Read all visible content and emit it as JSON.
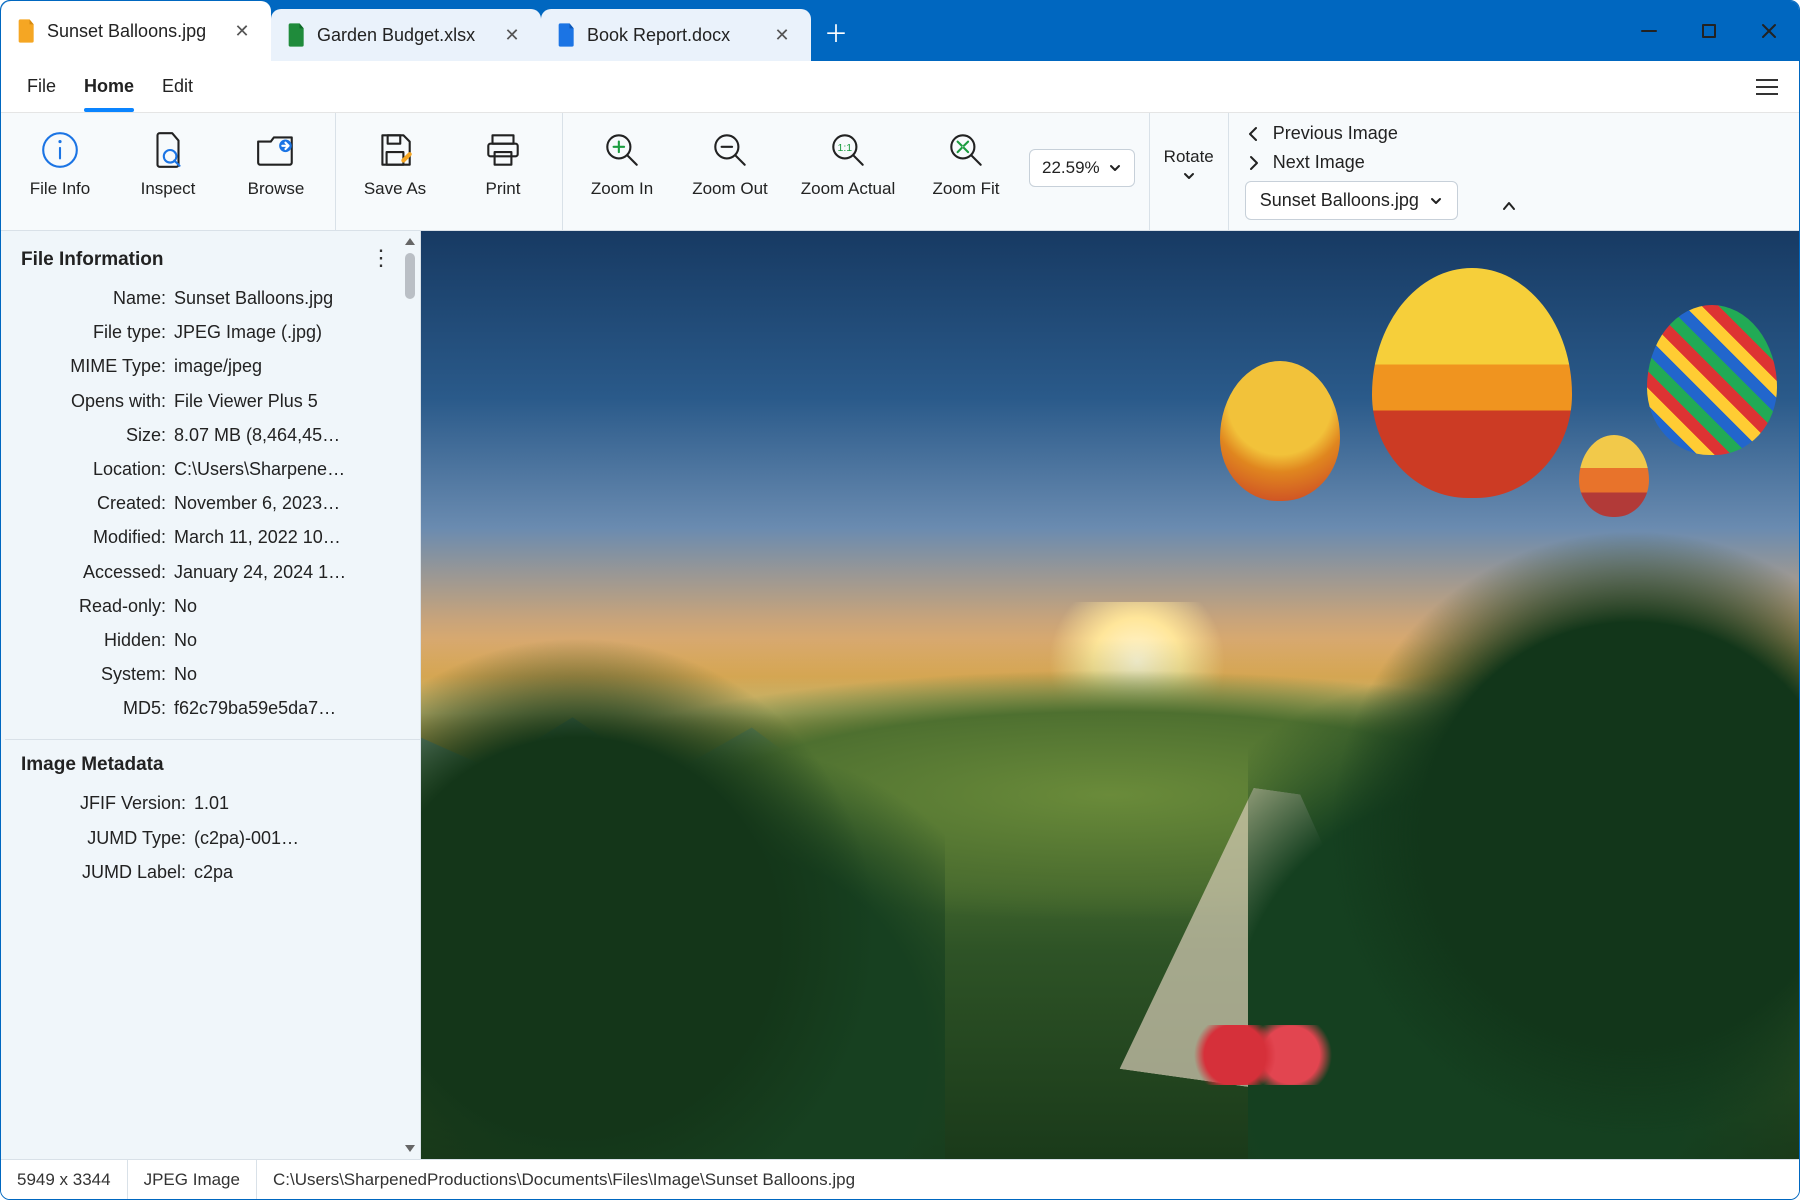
{
  "tabs": [
    {
      "label": "Sunset Balloons.jpg",
      "icon": "orange"
    },
    {
      "label": "Garden Budget.xlsx",
      "icon": "green"
    },
    {
      "label": "Book Report.docx",
      "icon": "blue"
    }
  ],
  "menus": {
    "file": "File",
    "home": "Home",
    "edit": "Edit"
  },
  "ribbon": {
    "file_info": "File Info",
    "inspect": "Inspect",
    "browse": "Browse",
    "save_as": "Save As",
    "print": "Print",
    "zoom_in": "Zoom In",
    "zoom_out": "Zoom Out",
    "zoom_actual": "Zoom Actual",
    "zoom_fit": "Zoom Fit",
    "zoom_value": "22.59%",
    "rotate": "Rotate",
    "prev": "Previous Image",
    "next": "Next Image",
    "current_file": "Sunset Balloons.jpg"
  },
  "panel": {
    "file_info_title": "File Information",
    "rows": [
      {
        "k": "Name:",
        "v": "Sunset Balloons.jpg"
      },
      {
        "k": "File type:",
        "v": "JPEG Image (.jpg)"
      },
      {
        "k": "MIME Type:",
        "v": "image/jpeg"
      },
      {
        "k": "Opens with:",
        "v": "File Viewer Plus 5"
      },
      {
        "k": "Size:",
        "v": "8.07 MB (8,464,45…"
      },
      {
        "k": "Location:",
        "v": "C:\\Users\\Sharpene…"
      },
      {
        "k": "Created:",
        "v": "November 6, 2023…"
      },
      {
        "k": "Modified:",
        "v": "March 11, 2022 10…"
      },
      {
        "k": "Accessed:",
        "v": "January 24, 2024 1…"
      },
      {
        "k": "Read-only:",
        "v": "No"
      },
      {
        "k": "Hidden:",
        "v": "No"
      },
      {
        "k": "System:",
        "v": "No"
      },
      {
        "k": "MD5:",
        "v": "f62c79ba59e5da7…"
      }
    ],
    "meta_title": "Image Metadata",
    "meta_rows": [
      {
        "k": "JFIF Version:",
        "v": "1.01"
      },
      {
        "k": "JUMD Type:",
        "v": "(c2pa)-001…"
      },
      {
        "k": "JUMD Label:",
        "v": "c2pa"
      }
    ]
  },
  "status": {
    "dims": "5949 x 3344",
    "type": "JPEG Image",
    "path": "C:\\Users\\SharpenedProductions\\Documents\\Files\\Image\\Sunset Balloons.jpg"
  }
}
